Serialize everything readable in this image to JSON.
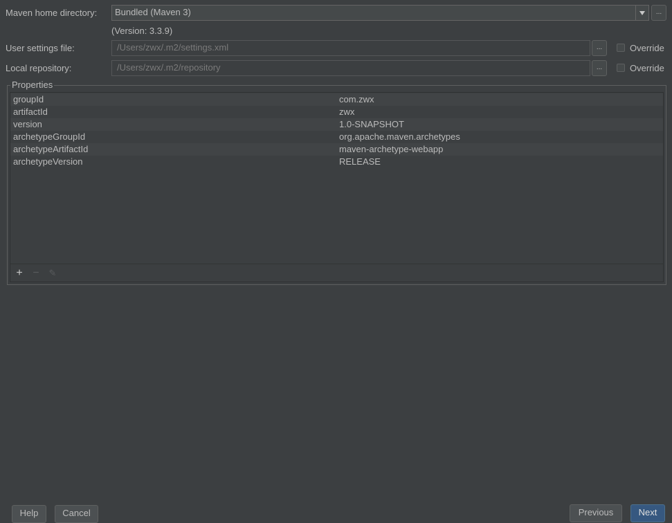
{
  "maven_home": {
    "label": "Maven home directory:",
    "value": "Bundled (Maven 3)",
    "browse": "...",
    "version_note": "(Version: 3.3.9)"
  },
  "user_settings": {
    "label": "User settings file:",
    "value": "/Users/zwx/.m2/settings.xml",
    "browse": "...",
    "override_label": "Override",
    "override_checked": false
  },
  "local_repo": {
    "label": "Local repository:",
    "value": "/Users/zwx/.m2/repository",
    "browse": "...",
    "override_label": "Override",
    "override_checked": false
  },
  "properties": {
    "legend": "Properties",
    "rows": [
      {
        "key": "groupId",
        "value": "com.zwx"
      },
      {
        "key": "artifactId",
        "value": "zwx"
      },
      {
        "key": "version",
        "value": "1.0-SNAPSHOT"
      },
      {
        "key": "archetypeGroupId",
        "value": "org.apache.maven.archetypes"
      },
      {
        "key": "archetypeArtifactId",
        "value": "maven-archetype-webapp"
      },
      {
        "key": "archetypeVersion",
        "value": "RELEASE"
      }
    ],
    "toolbar": {
      "add": "+",
      "remove": "−",
      "edit": "✎"
    }
  },
  "footer": {
    "help": "Help",
    "cancel": "Cancel",
    "previous": "Previous",
    "next": "Next"
  },
  "colors": {
    "background": "#3c3f41",
    "text": "#bbbbbb",
    "primary_button": "#365880"
  },
  "icons": {
    "dropdown": "chevron-down-icon",
    "browse": "ellipsis-icon",
    "add": "plus-icon",
    "remove": "minus-icon",
    "edit": "pencil-icon"
  }
}
